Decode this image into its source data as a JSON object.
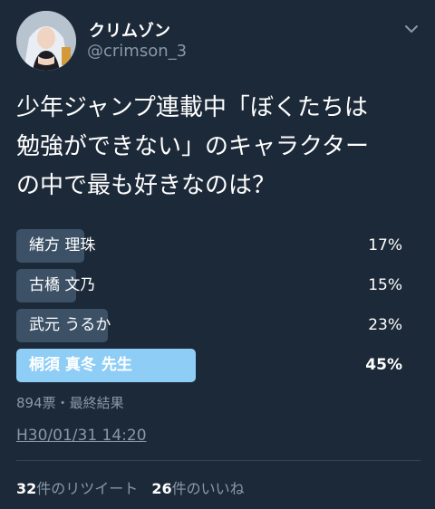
{
  "user": {
    "display_name": "クリムゾン",
    "handle": "@crimson_3"
  },
  "tweet": {
    "question_lines": [
      "少年ジャンプ連載中「ぼくたちは",
      "勉強ができない」のキャラクター",
      "の中で最も好きなのは？"
    ]
  },
  "poll": {
    "options": [
      {
        "label": "緒方 理珠",
        "percent_text": "17%",
        "percent": 17
      },
      {
        "label": "古橋 文乃",
        "percent_text": "15%",
        "percent": 15
      },
      {
        "label": "武元 うるか",
        "percent_text": "23%",
        "percent": 23
      },
      {
        "label": "桐須 真冬 先生",
        "percent_text": "45%",
        "percent": 45
      }
    ],
    "meta": "894票・最終結果"
  },
  "timestamp": "H30/01/31 14:20",
  "stats": {
    "retweet_count": "32",
    "retweet_label": "件のリツイート",
    "like_count": "26",
    "like_label": "件のいいね"
  },
  "colors": {
    "background": "#1c2938",
    "bar": "#3d5166",
    "winner_bar": "#8ecdf6",
    "secondary_text": "#8899a6"
  },
  "icons": {
    "menu": "chevron-down-icon"
  }
}
